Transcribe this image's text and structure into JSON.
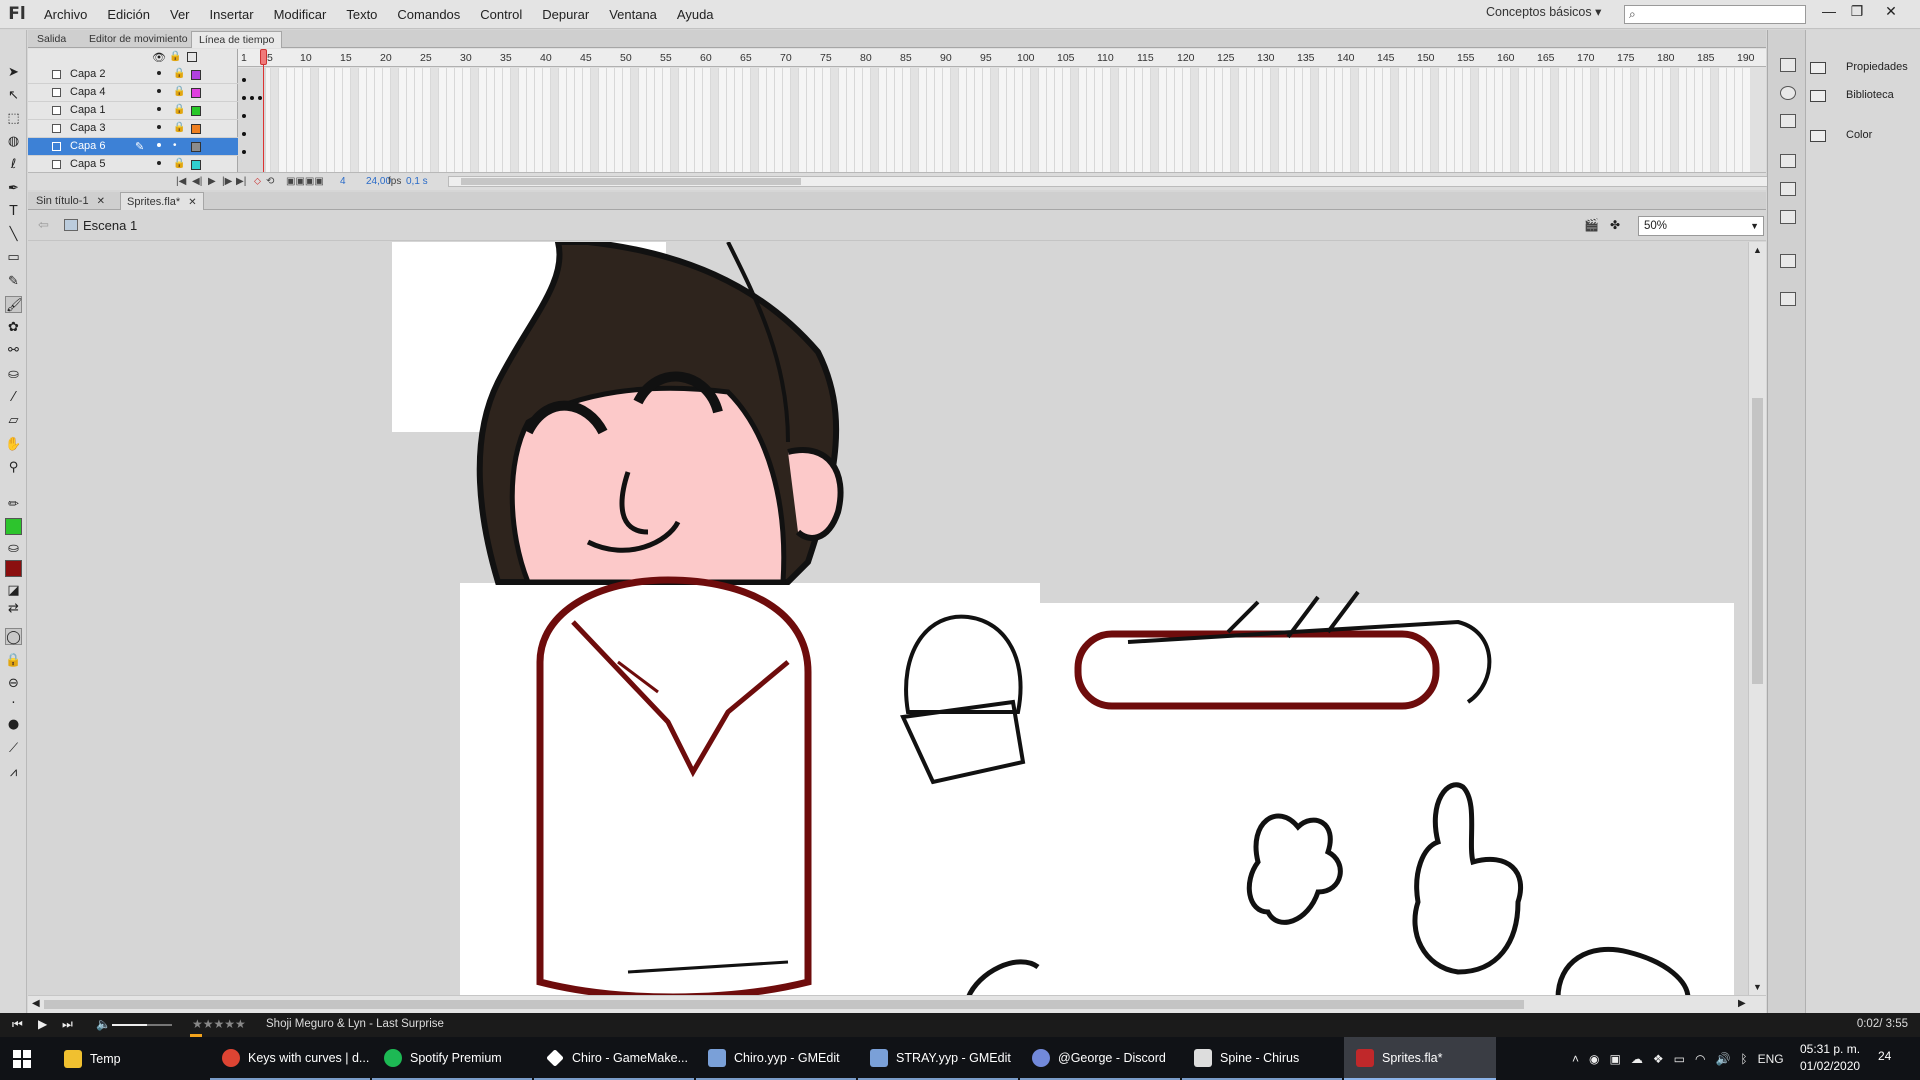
{
  "app": {
    "logo": "Fl",
    "menu": [
      "Archivo",
      "Edición",
      "Ver",
      "Insertar",
      "Modificar",
      "Texto",
      "Comandos",
      "Control",
      "Depurar",
      "Ventana",
      "Ayuda"
    ],
    "workspace": "Conceptos básicos ▾",
    "window_controls": [
      "—",
      "❐",
      "✕"
    ]
  },
  "timeline": {
    "tabs": [
      "Salida",
      "Editor de movimiento",
      "Línea de tiempo"
    ],
    "active_tab": "Línea de tiempo",
    "layers": [
      {
        "name": "Capa 2",
        "color": "#b040e0",
        "selected": false
      },
      {
        "name": "Capa 4",
        "color": "#e040e0",
        "selected": false
      },
      {
        "name": "Capa 1",
        "color": "#28c828",
        "selected": false
      },
      {
        "name": "Capa 3",
        "color": "#f08020",
        "selected": false
      },
      {
        "name": "Capa 6",
        "color": "#8c8c8c",
        "selected": true
      },
      {
        "name": "Capa 5",
        "color": "#30d0d0",
        "selected": false
      }
    ],
    "ruler": [
      "1",
      "5",
      "10",
      "15",
      "20",
      "25",
      "30",
      "35",
      "40",
      "45",
      "50",
      "55",
      "60",
      "65",
      "70",
      "75",
      "80",
      "85",
      "90",
      "95",
      "100",
      "105",
      "110",
      "115",
      "120",
      "125",
      "130",
      "135",
      "140",
      "145",
      "150",
      "155",
      "160",
      "165",
      "170",
      "175",
      "180",
      "185",
      "190"
    ],
    "current_frame": "4",
    "fps": "24,00",
    "fps_unit": "fps",
    "elapsed": "0,1 s"
  },
  "documents": {
    "tabs": [
      "Sin título-1",
      "Sprites.fla*"
    ],
    "active": "Sprites.fla*"
  },
  "editbar": {
    "scene": "Escena 1",
    "zoom": "50%"
  },
  "panels": {
    "items": [
      "Propiedades",
      "Biblioteca",
      "Color"
    ]
  },
  "media": {
    "controls": [
      "⏮",
      "▶",
      "⏭",
      "🔈"
    ],
    "rating": "★★★★★",
    "track": "Shoji Meguro & Lyn - Last Surprise",
    "time": "0:02/ 3:55"
  },
  "taskbar": {
    "start_icon": "windows-icon",
    "tasks": [
      {
        "label": "Temp",
        "color": "#f0c030"
      },
      {
        "label": "Keys with curves | d...",
        "color": "#dd4433"
      },
      {
        "label": "Spotify Premium",
        "color": "#1db954"
      },
      {
        "label": "Chiro - GameMake...",
        "color": "#ffffff"
      },
      {
        "label": "Chiro.yyp - GMEdit",
        "color": "#7aa0d8"
      },
      {
        "label": "STRAY.yyp - GMEdit",
        "color": "#7aa0d8"
      },
      {
        "label": "@George - Discord",
        "color": "#7289da"
      },
      {
        "label": "Spine - Chirus",
        "color": "#dddddd"
      },
      {
        "label": "Sprites.fla*",
        "color": "#c0282a"
      }
    ],
    "tray_lang": "ENG",
    "time": "05:31 p. m.",
    "date": "01/02/2020",
    "notifications": "24"
  }
}
